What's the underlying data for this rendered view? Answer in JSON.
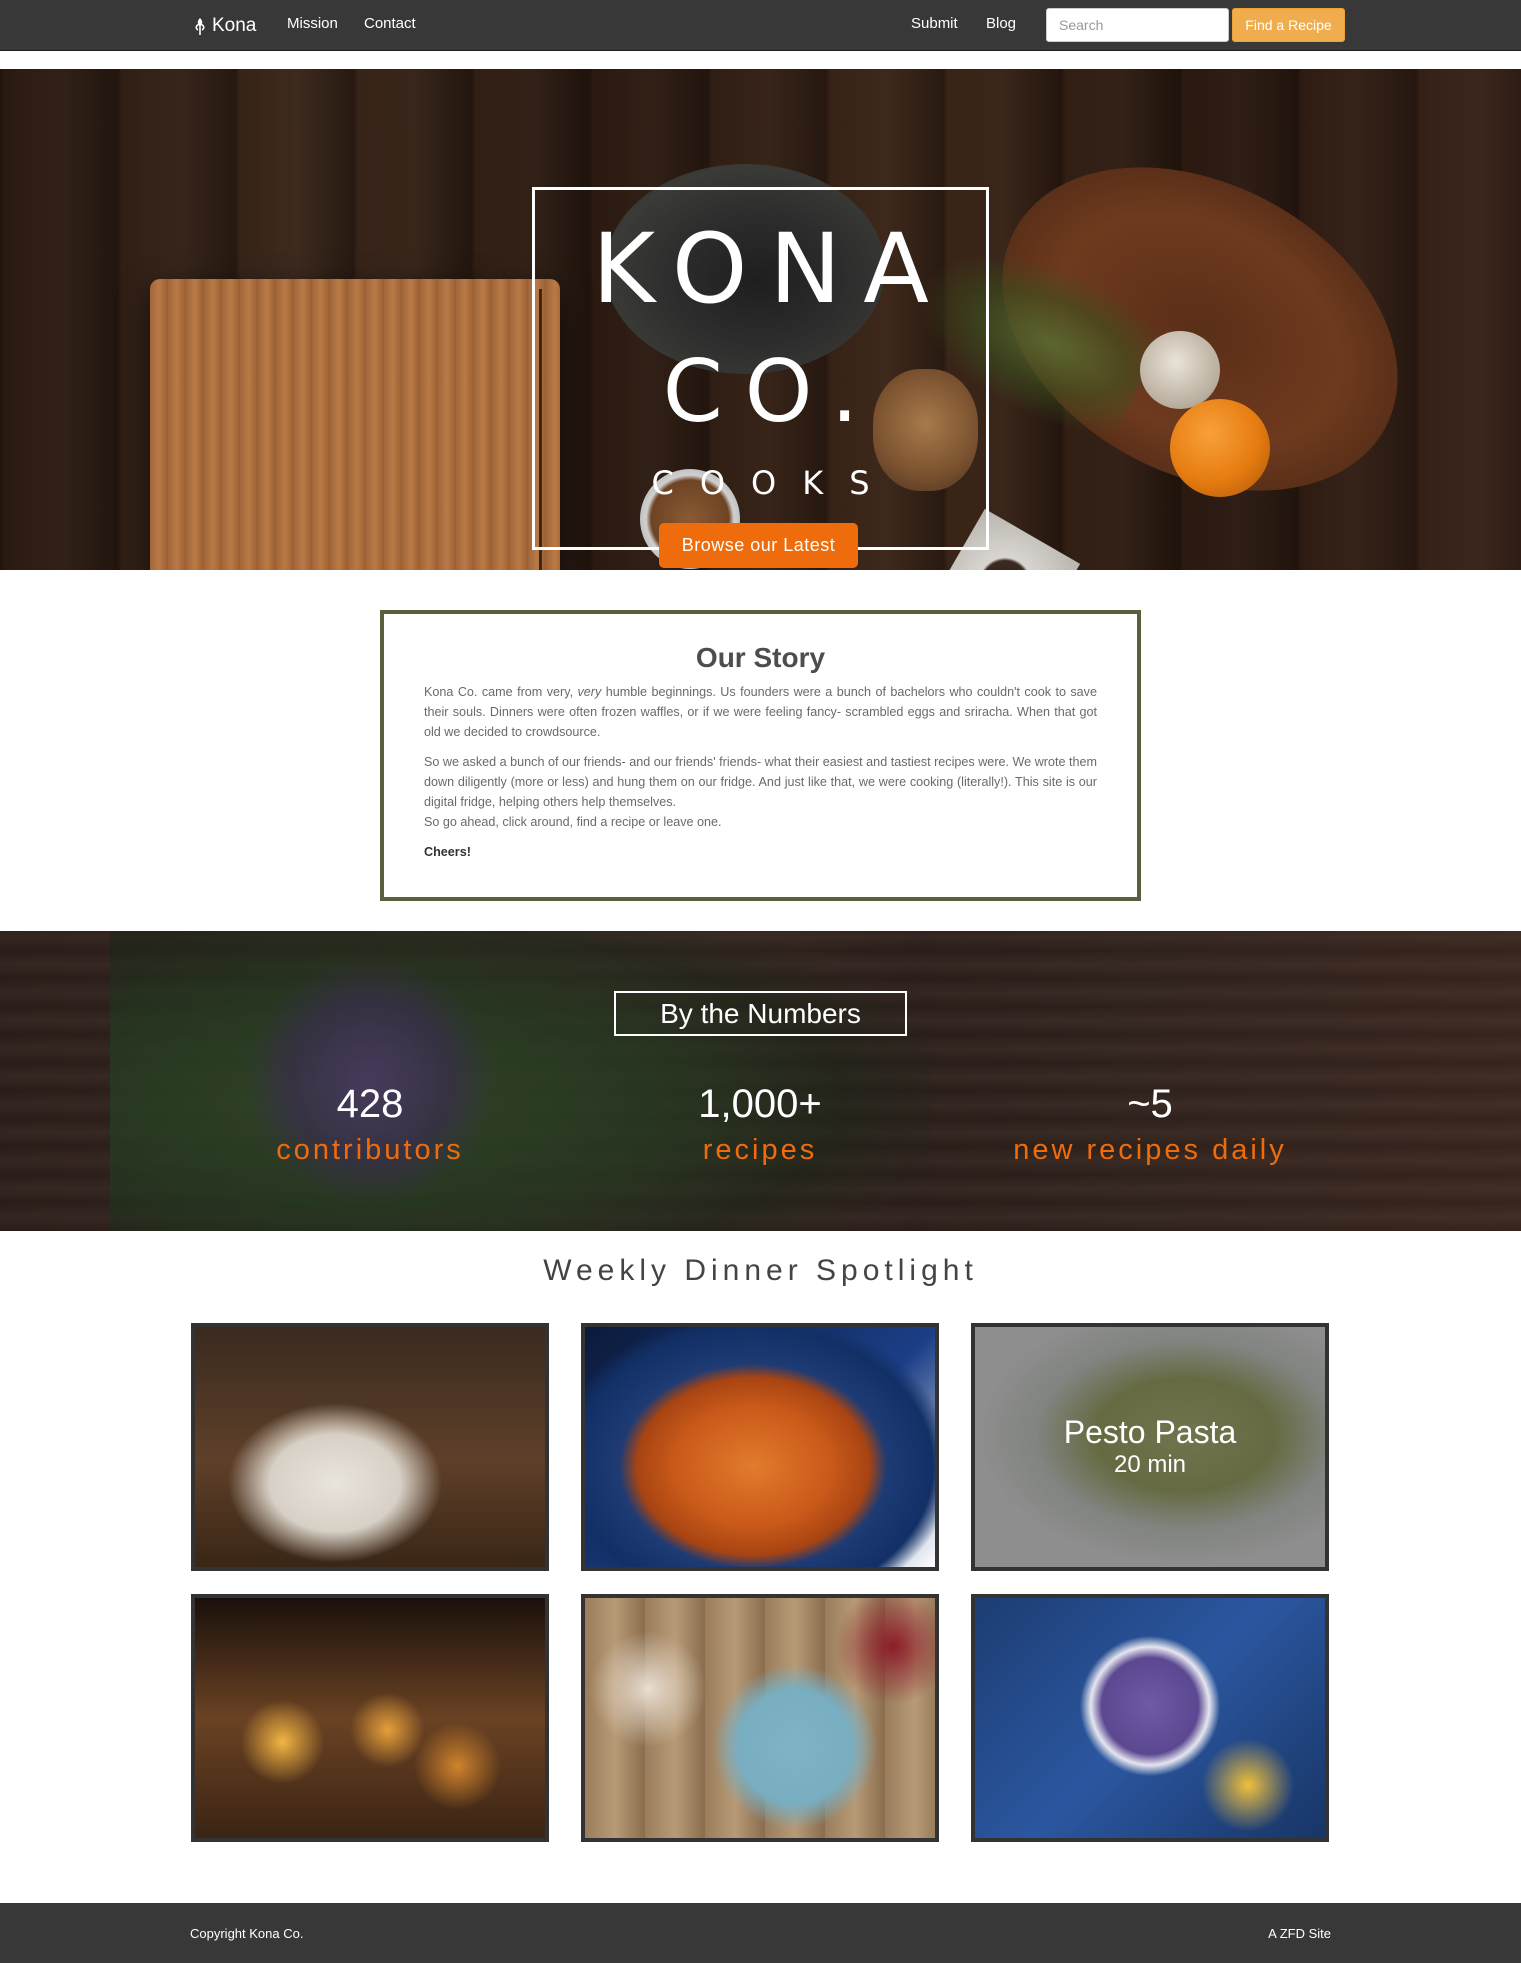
{
  "navbar": {
    "brand": "Kona",
    "links": [
      {
        "label": "Mission"
      },
      {
        "label": "Contact"
      },
      {
        "label": "Submit"
      },
      {
        "label": "Blog"
      }
    ],
    "search_placeholder": "Search",
    "search_button": "Find a Recipe",
    "accent": "#f0ad4e"
  },
  "hero": {
    "title_line1": "KONA",
    "title_line2": "CO.",
    "subtitle": "COOKS",
    "cta": "Browse our Latest",
    "cta_color": "#ee6c0c"
  },
  "story": {
    "heading": "Our Story",
    "p1_a": "Kona Co. came from very, ",
    "p1_em": "very",
    "p1_b": " humble beginnings. Us founders were a bunch of bachelors who couldn't cook to save their souls. Dinners were often frozen waffles, or if we were feeling fancy- scrambled eggs and sriracha. When that got old we decided to crowdsource.",
    "p2": "So we asked a bunch of our friends- and our friends' friends- what their easiest and tastiest recipes were. We wrote them down diligently (more or less) and hung them on our fridge. And just like that, we were cooking (literally!). This site is our digital fridge, helping others help themselves.",
    "p3": "So go ahead, click around, find a recipe or leave one.",
    "signoff": "Cheers!"
  },
  "numbers": {
    "heading": "By the Numbers",
    "stats": [
      {
        "value": "428",
        "label": "contributors"
      },
      {
        "value": "1,000+",
        "label": "recipes"
      },
      {
        "value": "~5",
        "label": "new recipes daily"
      }
    ]
  },
  "spotlight": {
    "heading": "Weekly Dinner Spotlight",
    "cards": [
      {
        "image": "pancakes"
      },
      {
        "image": "paella"
      },
      {
        "image": "pesto-pasta",
        "name": "Pesto Pasta",
        "time": "20 min"
      },
      {
        "image": "dim-sum"
      },
      {
        "image": "breakfast-spread"
      },
      {
        "image": "smoothie-bowl"
      }
    ]
  },
  "footer": {
    "copyright": "Copyright Kona Co.",
    "credit": "A ZFD Site"
  }
}
